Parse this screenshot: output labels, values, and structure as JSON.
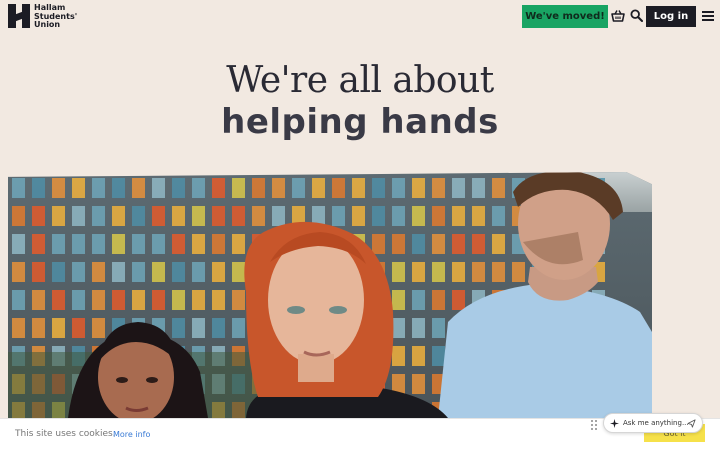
{
  "header": {
    "logo_lines": [
      "Hallam",
      "Students'",
      "Union"
    ],
    "moved_label": "We've moved!",
    "login_label": "Log in",
    "icons": [
      "basket-icon",
      "search-icon",
      "menu-icon"
    ]
  },
  "hero": {
    "line1": "We're all about",
    "line2": "helping hands"
  },
  "cookie": {
    "text": "This site uses cookies.",
    "more_info": "More info",
    "button": "Got it"
  },
  "assistant": {
    "placeholder": "Ask me anything..."
  },
  "colors": {
    "background": "#f2e9e1",
    "moved_button": "#19a463",
    "login_button": "#1c1c24",
    "cookie_button": "#f6e14a"
  }
}
